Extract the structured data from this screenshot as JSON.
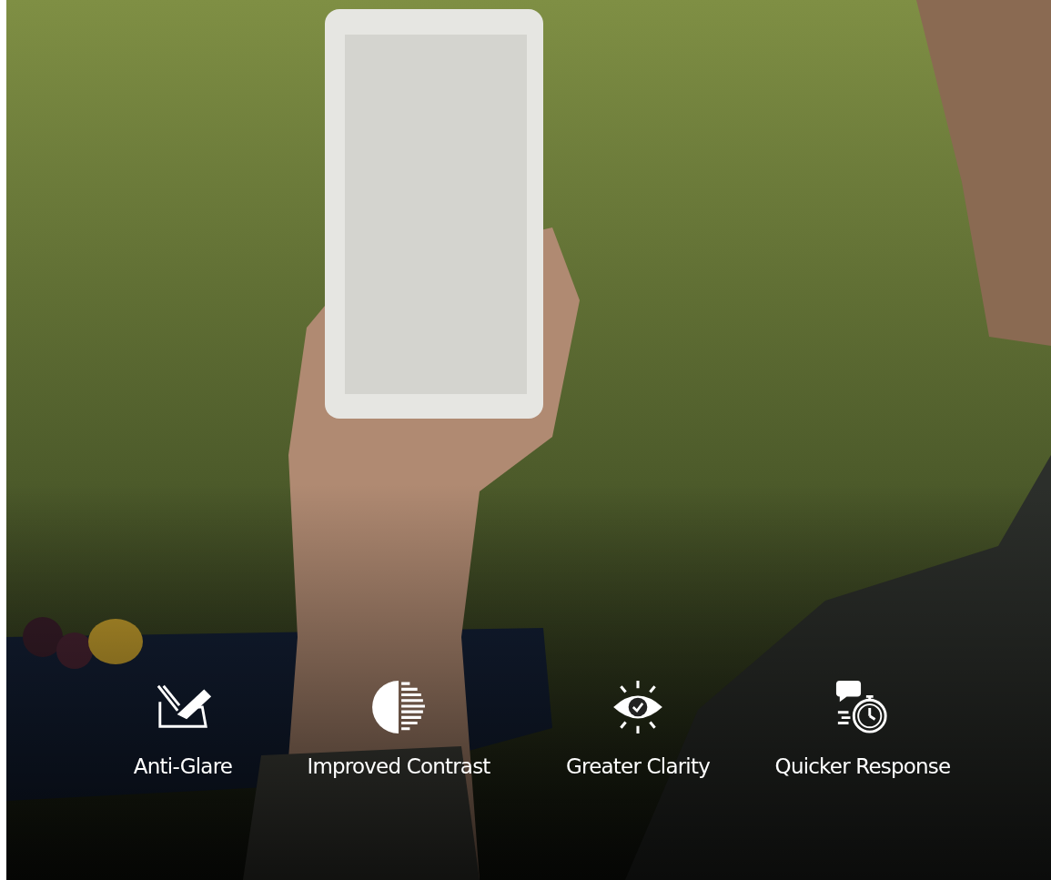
{
  "features": [
    {
      "kind": "glare",
      "label": "Anti-Glare"
    },
    {
      "kind": "contrast",
      "label": "Improved Contrast"
    },
    {
      "kind": "clarity",
      "label": "Greater Clarity"
    },
    {
      "kind": "response",
      "label": "Quicker Response"
    }
  ]
}
